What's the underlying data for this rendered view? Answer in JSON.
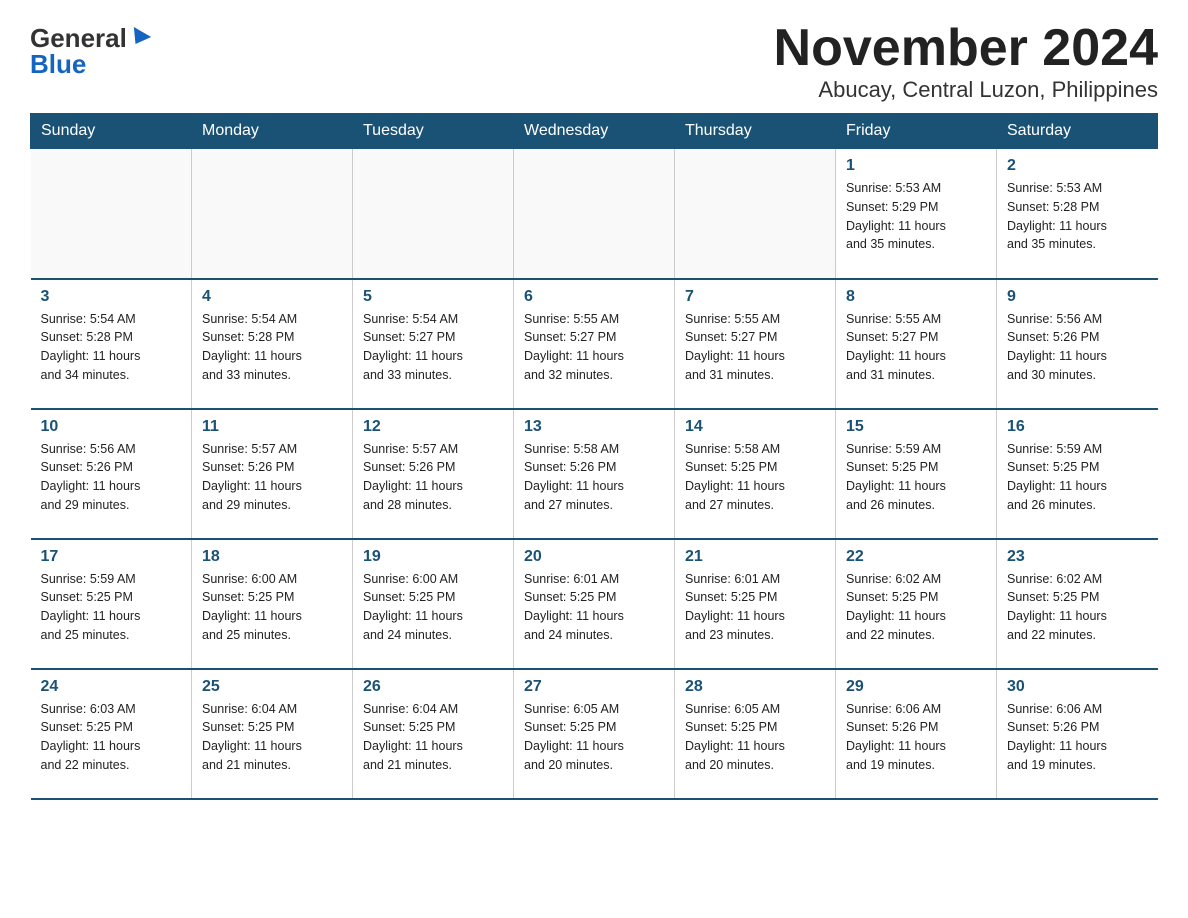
{
  "header": {
    "logo_general": "General",
    "logo_blue": "Blue",
    "title": "November 2024",
    "subtitle": "Abucay, Central Luzon, Philippines"
  },
  "weekdays": [
    "Sunday",
    "Monday",
    "Tuesday",
    "Wednesday",
    "Thursday",
    "Friday",
    "Saturday"
  ],
  "weeks": [
    [
      {
        "day": "",
        "info": ""
      },
      {
        "day": "",
        "info": ""
      },
      {
        "day": "",
        "info": ""
      },
      {
        "day": "",
        "info": ""
      },
      {
        "day": "",
        "info": ""
      },
      {
        "day": "1",
        "info": "Sunrise: 5:53 AM\nSunset: 5:29 PM\nDaylight: 11 hours\nand 35 minutes."
      },
      {
        "day": "2",
        "info": "Sunrise: 5:53 AM\nSunset: 5:28 PM\nDaylight: 11 hours\nand 35 minutes."
      }
    ],
    [
      {
        "day": "3",
        "info": "Sunrise: 5:54 AM\nSunset: 5:28 PM\nDaylight: 11 hours\nand 34 minutes."
      },
      {
        "day": "4",
        "info": "Sunrise: 5:54 AM\nSunset: 5:28 PM\nDaylight: 11 hours\nand 33 minutes."
      },
      {
        "day": "5",
        "info": "Sunrise: 5:54 AM\nSunset: 5:27 PM\nDaylight: 11 hours\nand 33 minutes."
      },
      {
        "day": "6",
        "info": "Sunrise: 5:55 AM\nSunset: 5:27 PM\nDaylight: 11 hours\nand 32 minutes."
      },
      {
        "day": "7",
        "info": "Sunrise: 5:55 AM\nSunset: 5:27 PM\nDaylight: 11 hours\nand 31 minutes."
      },
      {
        "day": "8",
        "info": "Sunrise: 5:55 AM\nSunset: 5:27 PM\nDaylight: 11 hours\nand 31 minutes."
      },
      {
        "day": "9",
        "info": "Sunrise: 5:56 AM\nSunset: 5:26 PM\nDaylight: 11 hours\nand 30 minutes."
      }
    ],
    [
      {
        "day": "10",
        "info": "Sunrise: 5:56 AM\nSunset: 5:26 PM\nDaylight: 11 hours\nand 29 minutes."
      },
      {
        "day": "11",
        "info": "Sunrise: 5:57 AM\nSunset: 5:26 PM\nDaylight: 11 hours\nand 29 minutes."
      },
      {
        "day": "12",
        "info": "Sunrise: 5:57 AM\nSunset: 5:26 PM\nDaylight: 11 hours\nand 28 minutes."
      },
      {
        "day": "13",
        "info": "Sunrise: 5:58 AM\nSunset: 5:26 PM\nDaylight: 11 hours\nand 27 minutes."
      },
      {
        "day": "14",
        "info": "Sunrise: 5:58 AM\nSunset: 5:25 PM\nDaylight: 11 hours\nand 27 minutes."
      },
      {
        "day": "15",
        "info": "Sunrise: 5:59 AM\nSunset: 5:25 PM\nDaylight: 11 hours\nand 26 minutes."
      },
      {
        "day": "16",
        "info": "Sunrise: 5:59 AM\nSunset: 5:25 PM\nDaylight: 11 hours\nand 26 minutes."
      }
    ],
    [
      {
        "day": "17",
        "info": "Sunrise: 5:59 AM\nSunset: 5:25 PM\nDaylight: 11 hours\nand 25 minutes."
      },
      {
        "day": "18",
        "info": "Sunrise: 6:00 AM\nSunset: 5:25 PM\nDaylight: 11 hours\nand 25 minutes."
      },
      {
        "day": "19",
        "info": "Sunrise: 6:00 AM\nSunset: 5:25 PM\nDaylight: 11 hours\nand 24 minutes."
      },
      {
        "day": "20",
        "info": "Sunrise: 6:01 AM\nSunset: 5:25 PM\nDaylight: 11 hours\nand 24 minutes."
      },
      {
        "day": "21",
        "info": "Sunrise: 6:01 AM\nSunset: 5:25 PM\nDaylight: 11 hours\nand 23 minutes."
      },
      {
        "day": "22",
        "info": "Sunrise: 6:02 AM\nSunset: 5:25 PM\nDaylight: 11 hours\nand 22 minutes."
      },
      {
        "day": "23",
        "info": "Sunrise: 6:02 AM\nSunset: 5:25 PM\nDaylight: 11 hours\nand 22 minutes."
      }
    ],
    [
      {
        "day": "24",
        "info": "Sunrise: 6:03 AM\nSunset: 5:25 PM\nDaylight: 11 hours\nand 22 minutes."
      },
      {
        "day": "25",
        "info": "Sunrise: 6:04 AM\nSunset: 5:25 PM\nDaylight: 11 hours\nand 21 minutes."
      },
      {
        "day": "26",
        "info": "Sunrise: 6:04 AM\nSunset: 5:25 PM\nDaylight: 11 hours\nand 21 minutes."
      },
      {
        "day": "27",
        "info": "Sunrise: 6:05 AM\nSunset: 5:25 PM\nDaylight: 11 hours\nand 20 minutes."
      },
      {
        "day": "28",
        "info": "Sunrise: 6:05 AM\nSunset: 5:25 PM\nDaylight: 11 hours\nand 20 minutes."
      },
      {
        "day": "29",
        "info": "Sunrise: 6:06 AM\nSunset: 5:26 PM\nDaylight: 11 hours\nand 19 minutes."
      },
      {
        "day": "30",
        "info": "Sunrise: 6:06 AM\nSunset: 5:26 PM\nDaylight: 11 hours\nand 19 minutes."
      }
    ]
  ]
}
